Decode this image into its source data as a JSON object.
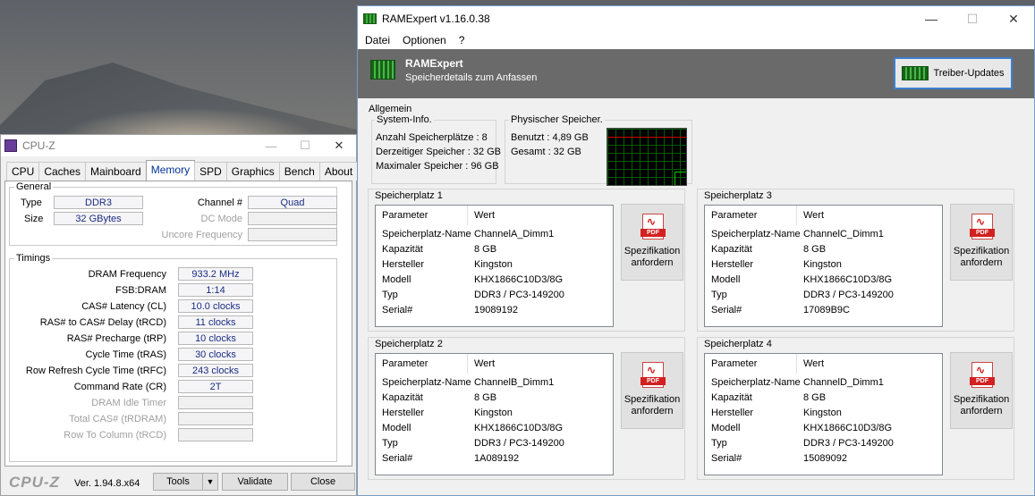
{
  "cpuz": {
    "title": "CPU-Z",
    "tabs": [
      "CPU",
      "Caches",
      "Mainboard",
      "Memory",
      "SPD",
      "Graphics",
      "Bench",
      "About"
    ],
    "selected_tab": "Memory",
    "general": {
      "legend": "General",
      "type_label": "Type",
      "type_value": "DDR3",
      "size_label": "Size",
      "size_value": "32 GBytes",
      "channel_label": "Channel #",
      "channel_value": "Quad",
      "dcmode_label": "DC Mode",
      "uncore_label": "Uncore Frequency"
    },
    "timings": {
      "legend": "Timings",
      "rows": [
        {
          "label": "DRAM Frequency",
          "value": "933.2 MHz"
        },
        {
          "label": "FSB:DRAM",
          "value": "1:14"
        },
        {
          "label": "CAS# Latency (CL)",
          "value": "10.0 clocks"
        },
        {
          "label": "RAS# to CAS# Delay (tRCD)",
          "value": "11 clocks"
        },
        {
          "label": "RAS# Precharge (tRP)",
          "value": "10 clocks"
        },
        {
          "label": "Cycle Time (tRAS)",
          "value": "30 clocks"
        },
        {
          "label": "Row Refresh Cycle Time (tRFC)",
          "value": "243 clocks"
        },
        {
          "label": "Command Rate (CR)",
          "value": "2T"
        },
        {
          "label": "DRAM Idle Timer",
          "value": ""
        },
        {
          "label": "Total CAS# (tRDRAM)",
          "value": ""
        },
        {
          "label": "Row To Column (tRCD)",
          "value": ""
        }
      ]
    },
    "footer": {
      "brand": "CPU-Z",
      "version": "Ver. 1.94.8.x64",
      "tools_label": "Tools",
      "validate_label": "Validate",
      "close_label": "Close"
    }
  },
  "ramexpert": {
    "title": "RAMExpert v1.16.0.38",
    "menu": [
      "Datei",
      "Optionen",
      "?"
    ],
    "banner": {
      "title": "RAMExpert",
      "subtitle": "Speicherdetails zum Anfassen",
      "update_button": "Treiber-Updates"
    },
    "allgemein": "Allgemein",
    "sysinfo": {
      "header": "System-Info.",
      "lines": [
        "Anzahl Speicherplätze : 8",
        "Derzeitiger Speicher : 32 GB",
        "Maximaler Speicher : 96 GB"
      ]
    },
    "physical": {
      "header": "Physischer Speicher.",
      "lines": [
        "Benutzt : 4,89 GB",
        "Gesamt : 32 GB"
      ]
    },
    "table_headers": {
      "param": "Parameter",
      "value": "Wert"
    },
    "param_names": [
      "Speicherplatz-Name",
      "Kapazität",
      "Hersteller",
      "Modell",
      "Typ",
      "Serial#"
    ],
    "spec_button": {
      "line1": "Spezifikation",
      "line2": "anfordern",
      "badge": "PDF"
    },
    "slots": [
      {
        "title": "Speicherplatz 1",
        "values": [
          "ChannelA_Dimm1",
          "8 GB",
          "Kingston",
          "KHX1866C10D3/8G",
          "DDR3 / PC3-149200",
          "19089192"
        ]
      },
      {
        "title": "Speicherplatz 3",
        "values": [
          "ChannelC_Dimm1",
          "8 GB",
          "Kingston",
          "KHX1866C10D3/8G",
          "DDR3 / PC3-149200",
          "17089B9C"
        ]
      },
      {
        "title": "Speicherplatz 2",
        "values": [
          "ChannelB_Dimm1",
          "8 GB",
          "Kingston",
          "KHX1866C10D3/8G",
          "DDR3 / PC3-149200",
          "1A089192"
        ]
      },
      {
        "title": "Speicherplatz 4",
        "values": [
          "ChannelD_Dimm1",
          "8 GB",
          "Kingston",
          "KHX1866C10D3/8G",
          "DDR3 / PC3-149200",
          "15089092"
        ]
      }
    ]
  }
}
